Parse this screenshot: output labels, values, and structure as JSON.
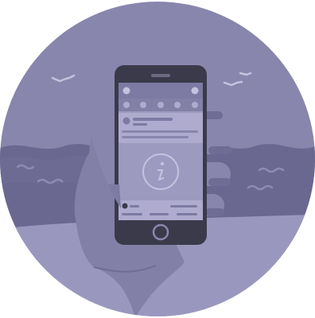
{
  "illustration": {
    "kind": "hand-holding-smartphone-at-beach",
    "icons": {
      "center_icon": "info-icon",
      "birds": "bird-icon",
      "waves": "wave-icon"
    },
    "colors": {
      "sky": "#8986ad",
      "sea_dark": "#6a6791",
      "sea_mid": "#7a77a0",
      "sand": "#9a97bf",
      "hand": "#8380a8",
      "hand_shade": "#6f6c95",
      "phone_body": "#3b3a4a",
      "screen": "#9d9ac0",
      "screen_light": "#aeabcf",
      "screen_dark": "#7d7aa3",
      "accent_line": "#c4c2de"
    }
  }
}
